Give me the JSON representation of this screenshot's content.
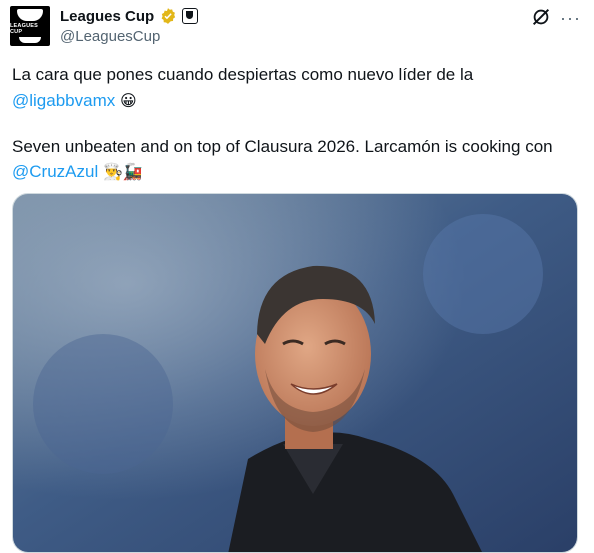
{
  "author": {
    "name": "Leagues Cup",
    "handle": "@LeaguesCup",
    "avatar_text": "LEAGUES CUP"
  },
  "tweet": {
    "line1": "La cara que pones cuando despiertas como nuevo líder de la",
    "mention1": "@ligabbvamx",
    "emoji1": "😀",
    "line3": "Seven unbeaten and on top of Clausura 2026. Larcamón is cooking con",
    "mention2": "@CruzAzul",
    "emoji2": "👨‍🍳🚂"
  },
  "colors": {
    "link": "#1d9bf0",
    "text": "#0f1419",
    "secondary": "#536471",
    "verified_gold": "#e2b719"
  },
  "icons": [
    "verified-badge-icon",
    "affiliate-badge-icon",
    "grok-icon",
    "more-icon"
  ]
}
